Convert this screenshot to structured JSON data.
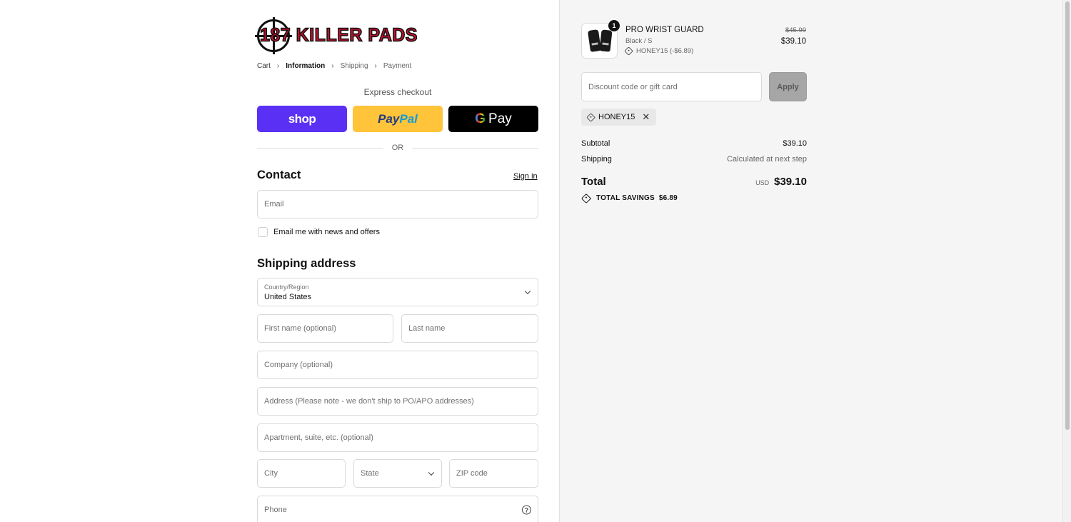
{
  "brand": {
    "logo_text": "187 KILLER PADS"
  },
  "breadcrumb": {
    "cart": "Cart",
    "information": "Information",
    "shipping": "Shipping",
    "payment": "Payment",
    "separator": "›"
  },
  "express": {
    "title": "Express checkout",
    "shop_label": "shop",
    "paypal_pay": "Pay",
    "paypal_pal": "Pal",
    "gpay_g": "G",
    "gpay_label": "Pay",
    "or_label": "OR"
  },
  "contact": {
    "heading": "Contact",
    "sign_in": "Sign in",
    "email_placeholder": "Email",
    "newsletter_label": "Email me with news and offers"
  },
  "shipping_address": {
    "heading": "Shipping address",
    "country_label": "Country/Region",
    "country_value": "United States",
    "first_name_placeholder": "First name (optional)",
    "last_name_placeholder": "Last name",
    "company_placeholder": "Company (optional)",
    "address_placeholder": "Address (Please note - we don't ship to PO/APO addresses)",
    "apartment_placeholder": "Apartment, suite, etc. (optional)",
    "city_placeholder": "City",
    "state_placeholder": "State",
    "zip_placeholder": "ZIP code",
    "phone_placeholder": "Phone",
    "help_glyph": "?"
  },
  "order": {
    "item": {
      "quantity": "1",
      "name": "PRO WRIST GUARD",
      "variant": "Black / S",
      "discount": "HONEY15 (-$6.89)",
      "original_price": "$45.99",
      "price": "$39.10"
    },
    "discount_placeholder": "Discount code or gift card",
    "apply_label": "Apply",
    "applied_code": "HONEY15",
    "remove_glyph": "✕",
    "subtotal_label": "Subtotal",
    "subtotal_value": "$39.10",
    "shipping_label": "Shipping",
    "shipping_value": "Calculated at next step",
    "total_label": "Total",
    "total_currency": "USD",
    "total_value": "$39.10",
    "savings_label": "TOTAL SAVINGS",
    "savings_value": "$6.89"
  },
  "colors": {
    "shop_purple": "#5a31f4",
    "paypal_yellow": "#ffc439",
    "gpay_black": "#000000",
    "sidebar_bg": "#f5f5f5"
  }
}
